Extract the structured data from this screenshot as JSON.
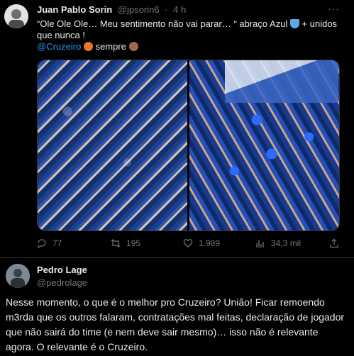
{
  "tweet1": {
    "author_name": "Juan Pablo Sorin",
    "author_handle": "@jpsorin6",
    "separator": "·",
    "time": "4 h",
    "more": "···",
    "text_part1": "“Ole Ole Ole… Meu sentimento não vai parar… “ abraço Azul ",
    "text_part2": " + unidos que nunca !",
    "mention": "@Cruzeiro",
    "text_part3": " sempre ",
    "emojis": [
      "blue-heart-emoji",
      "cat-emoji",
      "fist-emoji"
    ],
    "actions": {
      "replies": "77",
      "reposts": "195",
      "likes": "1.989",
      "views": "34,3 mil"
    }
  },
  "tweet2": {
    "author_name": "Pedro Lage",
    "author_handle": "@pedrolage",
    "text": "Nesse momento, o que é o melhor pro Cruzeiro? União! Ficar remoendo m3rda que os outros falaram, contratações mal feitas, declaração de jogador que não sairá do time (e nem deve sair mesmo)… isso não é relevante agora. O relevante é o Cruzeiro."
  },
  "colors": {
    "background": "#000000",
    "text": "#e7e9ea",
    "muted": "#71767b",
    "link": "#1d9bf0",
    "border": "#2f3336"
  }
}
